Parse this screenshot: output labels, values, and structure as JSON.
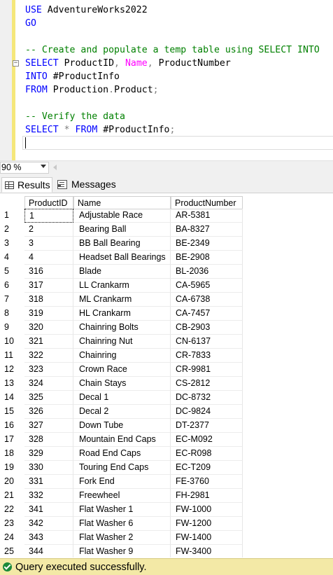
{
  "editor": {
    "lines": [
      {
        "id": "l1",
        "parts": [
          {
            "t": "USE",
            "c": "kw"
          },
          {
            "t": " AdventureWorks2022",
            "c": ""
          }
        ]
      },
      {
        "id": "l2",
        "parts": [
          {
            "t": "GO",
            "c": "kw"
          }
        ]
      },
      {
        "id": "l3",
        "parts": []
      },
      {
        "id": "l4",
        "parts": [
          {
            "t": "-- Create and populate a temp table using SELECT INTO",
            "c": "cm"
          }
        ]
      },
      {
        "id": "l5",
        "collapse": true,
        "parts": [
          {
            "t": "SELECT",
            "c": "kw"
          },
          {
            "t": " ProductID",
            "c": ""
          },
          {
            "t": ",",
            "c": "gr"
          },
          {
            "t": " Name",
            "c": "mg"
          },
          {
            "t": ",",
            "c": "gr"
          },
          {
            "t": " ProductNumber",
            "c": ""
          }
        ]
      },
      {
        "id": "l6",
        "parts": [
          {
            "t": "INTO",
            "c": "kw"
          },
          {
            "t": " #ProductInfo",
            "c": ""
          }
        ]
      },
      {
        "id": "l7",
        "parts": [
          {
            "t": "FROM",
            "c": "kw"
          },
          {
            "t": " Production",
            "c": ""
          },
          {
            "t": ".",
            "c": "gr"
          },
          {
            "t": "Product",
            "c": ""
          },
          {
            "t": ";",
            "c": "gr"
          }
        ]
      },
      {
        "id": "l8",
        "parts": []
      },
      {
        "id": "l9",
        "parts": [
          {
            "t": "-- Verify the data",
            "c": "cm"
          }
        ]
      },
      {
        "id": "l10",
        "parts": [
          {
            "t": "SELECT",
            "c": "kw"
          },
          {
            "t": " ",
            "c": ""
          },
          {
            "t": "*",
            "c": "gr"
          },
          {
            "t": " ",
            "c": ""
          },
          {
            "t": "FROM",
            "c": "kw"
          },
          {
            "t": " #ProductInfo",
            "c": ""
          },
          {
            "t": ";",
            "c": "gr"
          }
        ]
      }
    ]
  },
  "zoom": {
    "value": "90 %"
  },
  "tabs": {
    "results_label": "Results",
    "messages_label": "Messages"
  },
  "grid": {
    "columns": [
      "ProductID",
      "Name",
      "ProductNumber"
    ],
    "rows": [
      [
        "1",
        "1",
        "Adjustable Race",
        "AR-5381"
      ],
      [
        "2",
        "2",
        "Bearing Ball",
        "BA-8327"
      ],
      [
        "3",
        "3",
        "BB Ball Bearing",
        "BE-2349"
      ],
      [
        "4",
        "4",
        "Headset Ball Bearings",
        "BE-2908"
      ],
      [
        "5",
        "316",
        "Blade",
        "BL-2036"
      ],
      [
        "6",
        "317",
        "LL Crankarm",
        "CA-5965"
      ],
      [
        "7",
        "318",
        "ML Crankarm",
        "CA-6738"
      ],
      [
        "8",
        "319",
        "HL Crankarm",
        "CA-7457"
      ],
      [
        "9",
        "320",
        "Chainring Bolts",
        "CB-2903"
      ],
      [
        "10",
        "321",
        "Chainring Nut",
        "CN-6137"
      ],
      [
        "11",
        "322",
        "Chainring",
        "CR-7833"
      ],
      [
        "12",
        "323",
        "Crown Race",
        "CR-9981"
      ],
      [
        "13",
        "324",
        "Chain Stays",
        "CS-2812"
      ],
      [
        "14",
        "325",
        "Decal 1",
        "DC-8732"
      ],
      [
        "15",
        "326",
        "Decal 2",
        "DC-9824"
      ],
      [
        "16",
        "327",
        "Down Tube",
        "DT-2377"
      ],
      [
        "17",
        "328",
        "Mountain End Caps",
        "EC-M092"
      ],
      [
        "18",
        "329",
        "Road End Caps",
        "EC-R098"
      ],
      [
        "19",
        "330",
        "Touring End Caps",
        "EC-T209"
      ],
      [
        "20",
        "331",
        "Fork End",
        "FE-3760"
      ],
      [
        "21",
        "332",
        "Freewheel",
        "FH-2981"
      ],
      [
        "22",
        "341",
        "Flat Washer 1",
        "FW-1000"
      ],
      [
        "23",
        "342",
        "Flat Washer 6",
        "FW-1200"
      ],
      [
        "24",
        "343",
        "Flat Washer 2",
        "FW-1400"
      ],
      [
        "25",
        "344",
        "Flat Washer 9",
        "FW-3400"
      ]
    ]
  },
  "status": {
    "text": "Query executed successfully.",
    "color": "#f3e9a6"
  }
}
